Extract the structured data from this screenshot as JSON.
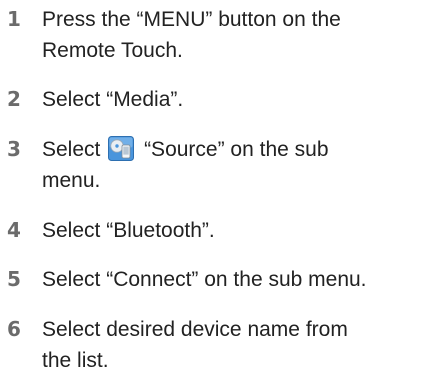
{
  "steps": [
    {
      "number": "1",
      "lines": [
        "Press the “MENU” button on the",
        "Remote Touch."
      ]
    },
    {
      "number": "2",
      "lines": [
        "Select “Media”."
      ]
    },
    {
      "number": "3",
      "pre_icon": "Select",
      "icon": "source-media-icon",
      "post_icon": "“Source” on the sub",
      "lines": [
        "menu."
      ]
    },
    {
      "number": "4",
      "lines": [
        "Select “Bluetooth”."
      ]
    },
    {
      "number": "5",
      "lines": [
        "Select “Connect” on the sub menu."
      ]
    },
    {
      "number": "6",
      "lines": [
        "Select desired device name from",
        "the list."
      ]
    }
  ],
  "colors": {
    "step_number": "#6b6b6b",
    "body_text": "#222222",
    "icon_blue": "#3a8ad6"
  }
}
